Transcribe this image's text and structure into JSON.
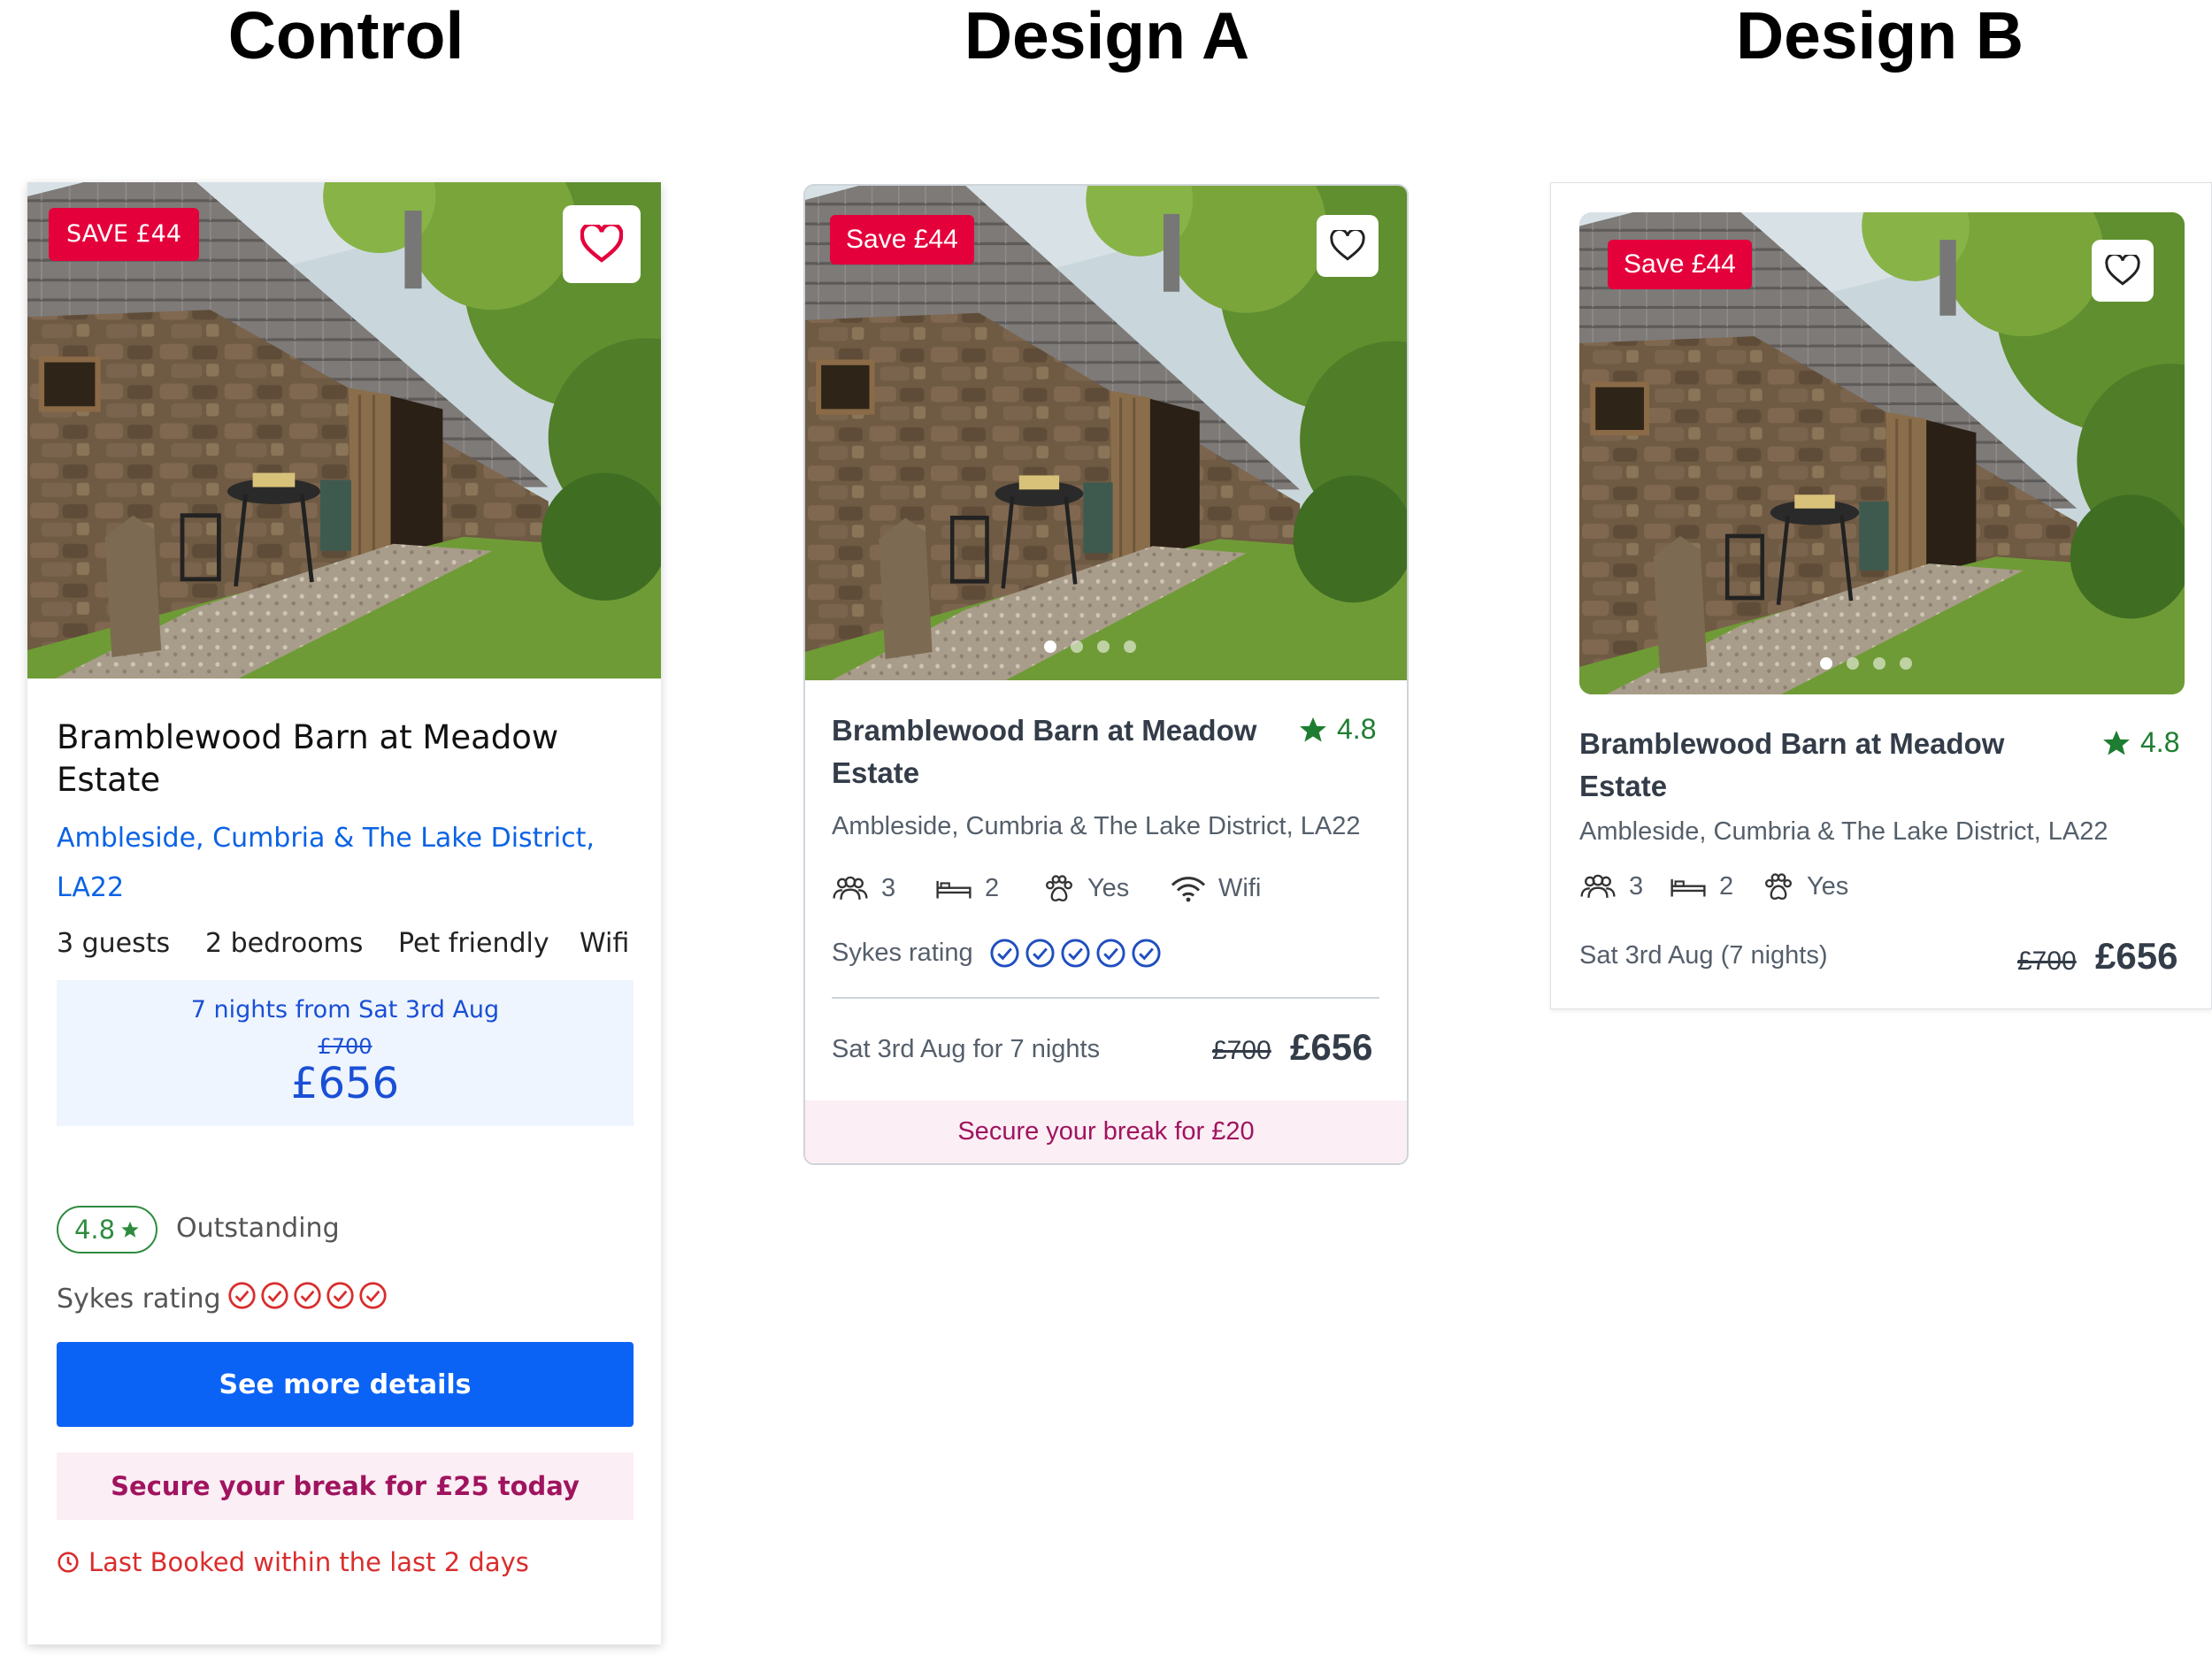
{
  "titles": {
    "control": "Control",
    "design_a": "Design A",
    "design_b": "Design B"
  },
  "colors": {
    "sale_badge": "#e4003b",
    "link_blue": "#0b63e5",
    "button_blue": "#0b63f6",
    "rating_green": "#1e7d32",
    "secure_pink": "#a0145f",
    "sykes_red": "#d92d2d",
    "sykes_blue": "#1f4fbf"
  },
  "control": {
    "badge": "SAVE £44",
    "property_name": "Bramblewood Barn at Meadow Estate",
    "location": "Ambleside, Cumbria & The Lake District, LA22",
    "features": [
      "3 guests",
      "2 bedrooms",
      "Pet friendly",
      "Wifi"
    ],
    "price_caption": "7 nights from Sat 3rd Aug",
    "old_price": "£700",
    "price": "£656",
    "score": "4.8",
    "score_label": "Outstanding",
    "sykes_label": "Sykes rating",
    "sykes_rating": 5,
    "details_button": "See more details",
    "secure_text": "Secure your break for £25 today",
    "last_booked": "Last Booked within the last 2 days",
    "icons": [
      "heart-icon",
      "star-icon",
      "sykes-check-icon",
      "clock-icon"
    ]
  },
  "design_a": {
    "badge": "Save £44",
    "property_name": "Bramblewood Barn at Meadow Estate",
    "rating": "4.8",
    "location": "Ambleside, Cumbria & The Lake District, LA22",
    "features": [
      {
        "icon": "guests-icon",
        "value": "3"
      },
      {
        "icon": "bed-icon",
        "value": "2"
      },
      {
        "icon": "paw-icon",
        "value": "Yes"
      },
      {
        "icon": "wifi-icon",
        "value": "Wifi"
      }
    ],
    "sykes_label": "Sykes rating",
    "sykes_rating": 5,
    "date_text": "Sat 3rd Aug for 7 nights",
    "old_price": "£700",
    "price": "£656",
    "secure_text": "Secure your break for £20",
    "carousel_total": 4,
    "carousel_active": 1
  },
  "design_b": {
    "badge": "Save £44",
    "property_name": "Bramblewood Barn at Meadow Estate",
    "rating": "4.8",
    "location": "Ambleside, Cumbria & The Lake District, LA22",
    "features": [
      {
        "icon": "guests-icon",
        "value": "3"
      },
      {
        "icon": "bed-icon",
        "value": "2"
      },
      {
        "icon": "paw-icon",
        "value": "Yes"
      }
    ],
    "date_text": "Sat 3rd Aug (7 nights)",
    "old_price": "£700",
    "price": "£656",
    "carousel_total": 4,
    "carousel_active": 1
  }
}
